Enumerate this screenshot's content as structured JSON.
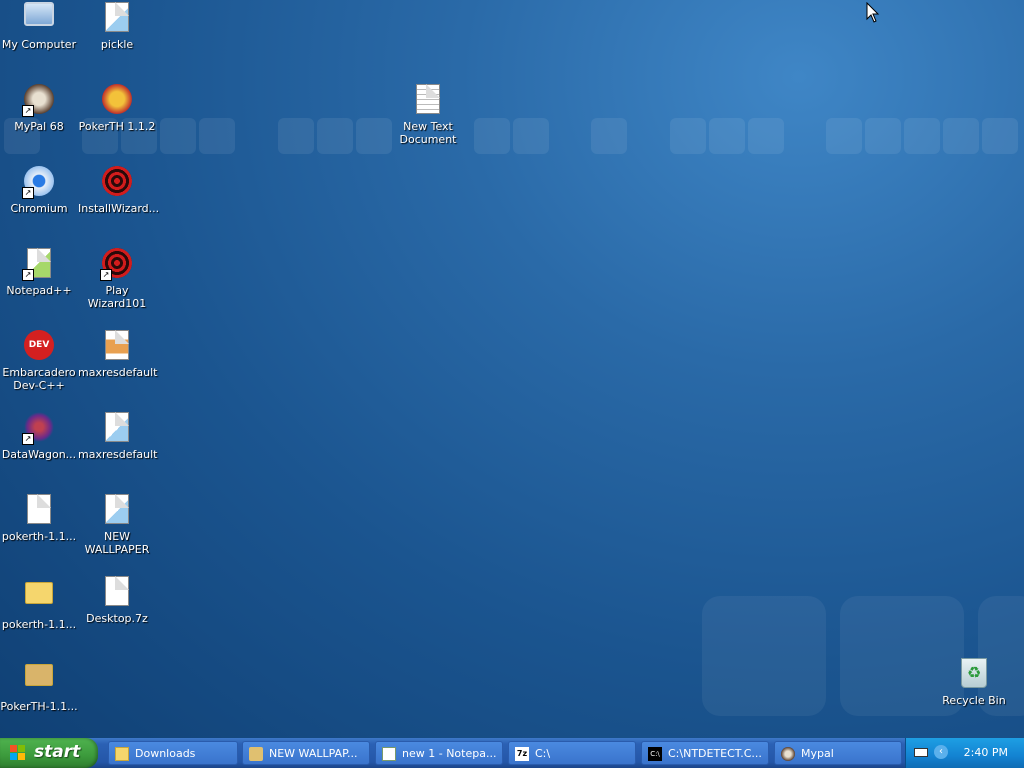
{
  "desktop": {
    "icons": [
      {
        "label": "My Computer"
      },
      {
        "label": "pickle"
      },
      {
        "label": "MyPal 68"
      },
      {
        "label": "PokerTH 1.1.2"
      },
      {
        "label": "New Text\nDocument"
      },
      {
        "label": "Chromium"
      },
      {
        "label": "InstallWizard..."
      },
      {
        "label": "Notepad++"
      },
      {
        "label": "Play Wizard101"
      },
      {
        "label": "Embarcadero\nDev-C++"
      },
      {
        "label": "maxresdefault"
      },
      {
        "label": "DataWagon..."
      },
      {
        "label": "maxresdefault"
      },
      {
        "label": "pokerth-1.1..."
      },
      {
        "label": "NEW\nWALLPAPER"
      },
      {
        "label": "pokerth-1.1..."
      },
      {
        "label": "Desktop.7z"
      },
      {
        "label": "PokerTH-1.1..."
      },
      {
        "label": "Recycle Bin"
      }
    ]
  },
  "taskbar": {
    "start_label": "start",
    "tasks": [
      {
        "label": "Downloads",
        "icon": "folder-icon"
      },
      {
        "label": "NEW WALLPAP...",
        "icon": "paint-icon"
      },
      {
        "label": "new 1 - Notepa...",
        "icon": "notepad-icon"
      },
      {
        "label": "C:\\",
        "icon": "7zip-icon"
      },
      {
        "label": "C:\\NTDETECT.C...",
        "icon": "console-icon"
      },
      {
        "label": "Mypal",
        "icon": "mypal-icon"
      }
    ],
    "clock": "2:40 PM"
  },
  "colors": {
    "desktop_blue": "#1b5590",
    "taskbar_blue": "#2456a8",
    "start_green": "#3c9a3c"
  }
}
